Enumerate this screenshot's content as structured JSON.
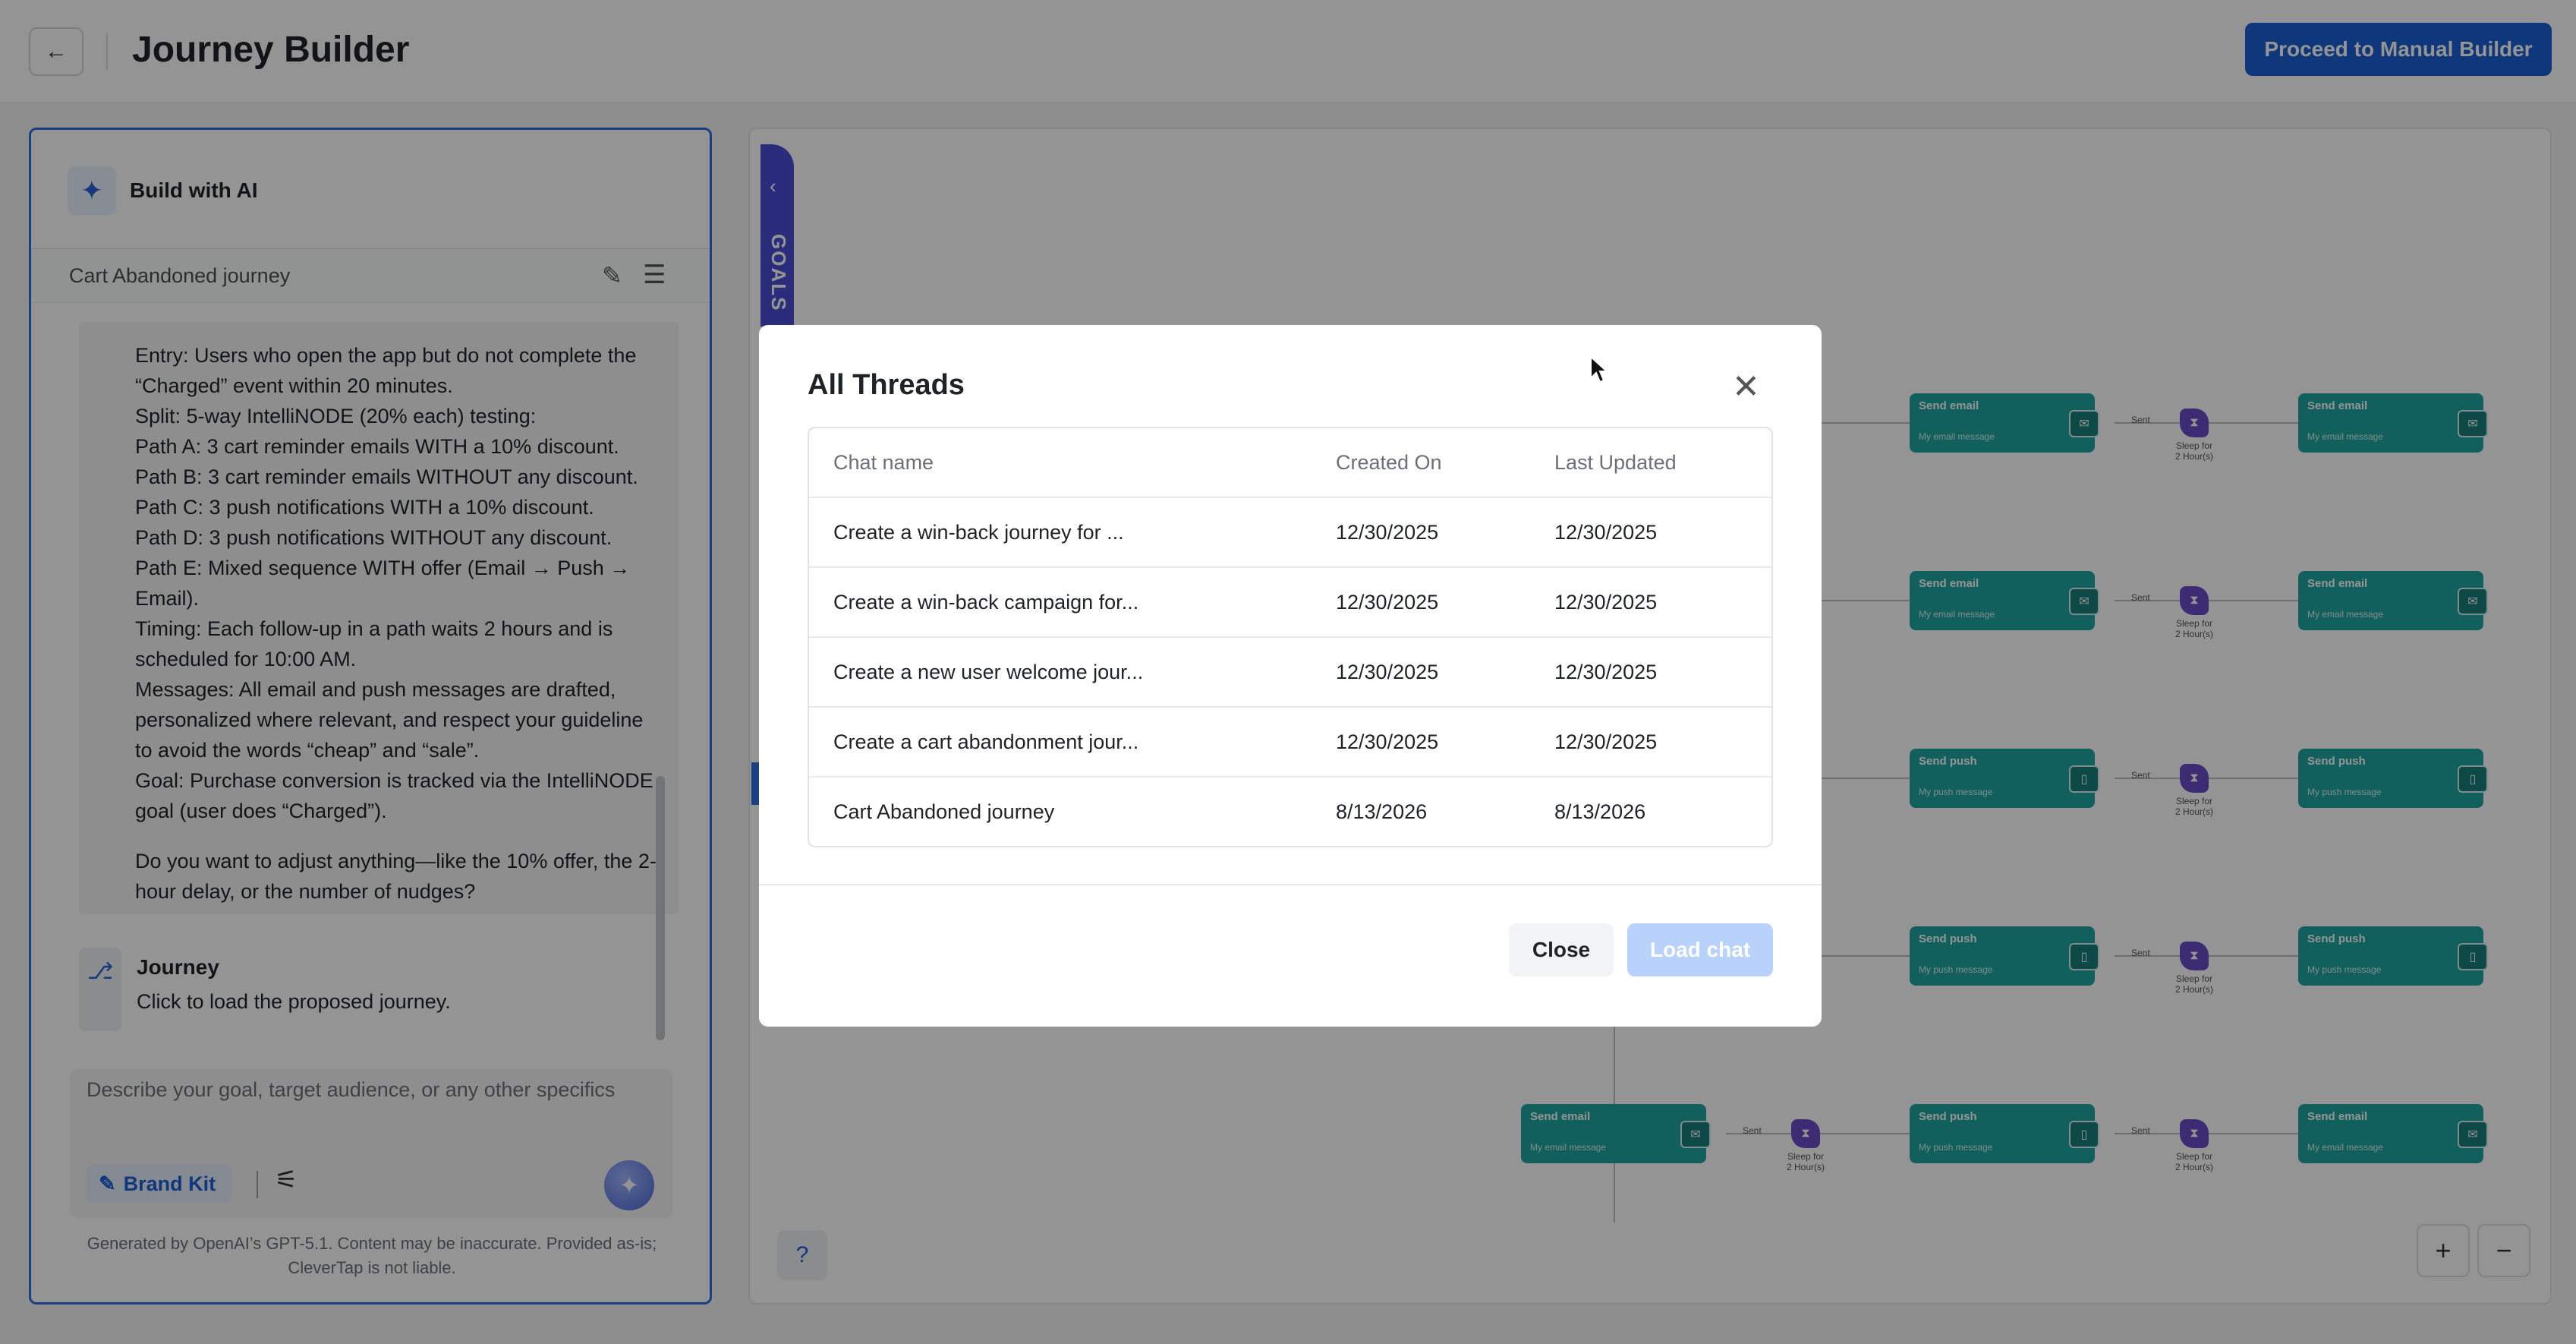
{
  "header": {
    "back_icon": "arrow-left-icon",
    "title": "Journey Builder",
    "proceed_label": "Proceed to Manual Builder"
  },
  "left_panel": {
    "ai_title": "Build with AI",
    "thread_name": "Cart Abandoned journey",
    "message_lines": [
      "Entry: Users who open the app but do not complete the “Charged” event within 20 minutes.",
      "Split: 5-way IntelliNODE (20% each) testing:",
      "Path A: 3 cart reminder emails WITH a 10% discount.",
      "Path B: 3 cart reminder emails WITHOUT any discount.",
      "Path C: 3 push notifications WITH a 10% discount.",
      "Path D: 3 push notifications WITHOUT any discount.",
      "Path E: Mixed sequence WITH offer (Email → Push → Email).",
      "Timing: Each follow-up in a path waits 2 hours and is scheduled for 10:00 AM.",
      "Messages: All email and push messages are drafted, personalized where relevant, and respect your guideline to avoid the words “cheap” and “sale”.",
      "Goal: Purchase conversion is tracked via the IntelliNODE goal (user does “Charged”)."
    ],
    "message_question": "Do you want to adjust anything—like the 10% offer, the 2-hour delay, or the number of nudges?",
    "journey_card": {
      "title": "Journey",
      "subtitle": "Click to load the proposed journey."
    },
    "input_placeholder": "Describe your goal, target audience, or any other specifics",
    "brand_kit_label": "Brand Kit",
    "disclaimer": "Generated by OpenAI’s GPT-5.1. Content may be inaccurate. Provided as-is; CleverTap is not liable."
  },
  "canvas": {
    "goals_label": "GOALS",
    "sent_label": "Sent",
    "sleep_label_1": "Sleep for",
    "sleep_label_2": "2 Hour(s)",
    "email_title": "Send email",
    "email_sub": "My email message",
    "push_title": "Send push",
    "push_sub": "My push message",
    "zoom_in": "+",
    "zoom_out": "−",
    "help": "?"
  },
  "modal": {
    "title": "All Threads",
    "columns": [
      "Chat name",
      "Created On",
      "Last Updated"
    ],
    "rows": [
      [
        "Create a win-back journey for ...",
        "12/30/2025",
        "12/30/2025"
      ],
      [
        "Create a win-back campaign for...",
        "12/30/2025",
        "12/30/2025"
      ],
      [
        "Create a new user welcome jour...",
        "12/30/2025",
        "12/30/2025"
      ],
      [
        "Create a cart abandonment jour...",
        "12/30/2025",
        "12/30/2025"
      ],
      [
        "Cart Abandoned journey",
        "8/13/2026",
        "8/13/2026"
      ]
    ],
    "close_label": "Close",
    "load_label": "Load chat"
  },
  "colors": {
    "primary": "#1a5fd6",
    "node_teal": "#1fa6a0",
    "sleep_purple": "#6a4cc7",
    "goals_tab": "#4a4fd6"
  }
}
